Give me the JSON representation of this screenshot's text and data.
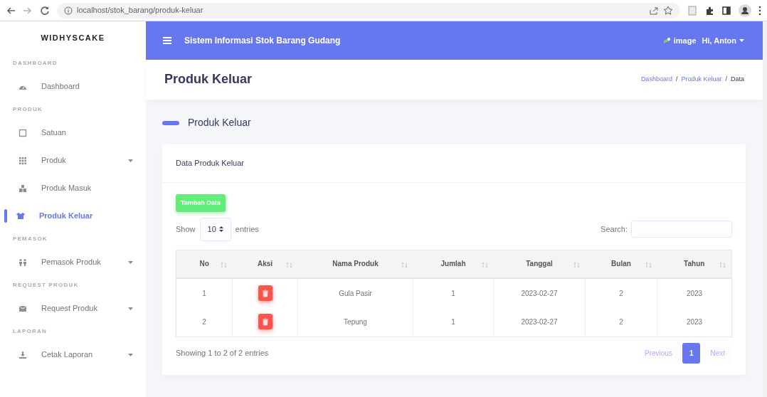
{
  "browser": {
    "url": "localhost/stok_barang/produk-keluar"
  },
  "sidebar": {
    "brand": "WIDHYSCAKE",
    "sections": [
      {
        "heading": "DASHBOARD",
        "items": [
          {
            "label": "Dashboard",
            "expandable": false,
            "selected": false
          }
        ]
      },
      {
        "heading": "PRODUK",
        "items": [
          {
            "label": "Satuan",
            "expandable": false,
            "selected": false
          },
          {
            "label": "Produk",
            "expandable": true,
            "selected": false
          },
          {
            "label": "Produk Masuk",
            "expandable": false,
            "selected": false
          },
          {
            "label": "Produk Keluar",
            "expandable": false,
            "selected": true
          }
        ]
      },
      {
        "heading": "PEMASOK",
        "items": [
          {
            "label": "Pemasok Produk",
            "expandable": true,
            "selected": false
          }
        ]
      },
      {
        "heading": "REQUEST PRODUK",
        "items": [
          {
            "label": "Request Produk",
            "expandable": true,
            "selected": false
          }
        ]
      },
      {
        "heading": "LAPORAN",
        "items": [
          {
            "label": "Cetak Laporan",
            "expandable": true,
            "selected": false
          }
        ]
      }
    ]
  },
  "header": {
    "title": "Sistem Informasi Stok Barang Gudang",
    "avatar_alt": "image",
    "user": "Hi, Anton"
  },
  "page_title": "Produk Keluar",
  "breadcrumbs": [
    {
      "label": "Dashboard",
      "kind": "link"
    },
    {
      "label": "/",
      "kind": "separator"
    },
    {
      "label": "Produk Keluar",
      "kind": "link"
    },
    {
      "label": "/",
      "kind": "separator"
    },
    {
      "label": "Data",
      "kind": "current"
    }
  ],
  "section_title": "Produk Keluar",
  "card": {
    "title": "Data Produk Keluar",
    "add_button": "Tambah Data",
    "show_label": "Show",
    "page_length": "10",
    "entries_label": "entries",
    "search_label": "Search:",
    "columns": [
      "No",
      "Aksi",
      "Nama Produk",
      "Jumlah",
      "Tanggal",
      "Bulan",
      "Tahun"
    ],
    "rows": [
      {
        "no": "1",
        "name": "Gula Pasir",
        "qty": "1",
        "date": "2023-02-27",
        "month": "2",
        "year": "2023"
      },
      {
        "no": "2",
        "name": "Tepung",
        "qty": "1",
        "date": "2023-02-27",
        "month": "2",
        "year": "2023"
      }
    ],
    "info": "Showing 1 to 2 of 2 entries",
    "pagination": {
      "previous": {
        "label": "Previous",
        "disabled": true
      },
      "pages": [
        {
          "label": "1",
          "selected": true
        }
      ],
      "next": {
        "label": "Next",
        "disabled": true
      }
    }
  }
}
